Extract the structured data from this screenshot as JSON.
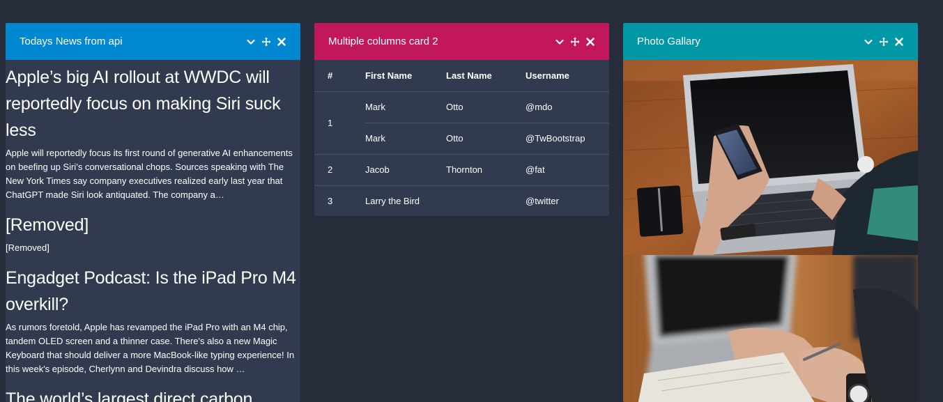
{
  "news_card": {
    "title": "Todays News from api",
    "header_color": "#0288d1",
    "articles": [
      {
        "title": "Apple’s big AI rollout at WWDC will reportedly focus on making Siri suck less",
        "description": "Apple will reportedly focus its first round of generative AI enhancements on beefing up Siri’s conversational chops. Sources speaking with The New York Times say company executives realized early last year that ChatGPT made Siri look antiquated. The company a…"
      },
      {
        "title": "[Removed]",
        "description": "[Removed]"
      },
      {
        "title": "Engadget Podcast: Is the iPad Pro M4 overkill?",
        "description": "As rumors foretold, Apple has revamped the iPad Pro with an M4 chip, tandem OLED screen and a thinner case. There's also a new Magic Keyboard that should deliver a more MacBook-like typing experience! In this week's episode, Cherlynn and Devindra discuss how …"
      },
      {
        "title": "The world’s largest direct carbon",
        "description": ""
      }
    ]
  },
  "table_card": {
    "title": "Multiple columns card 2",
    "header_color": "#c2185b",
    "columns": [
      "#",
      "First Name",
      "Last Name",
      "Username"
    ],
    "rows": [
      {
        "num": "1",
        "first": "Mark",
        "last": "Otto",
        "username": "@mdo"
      },
      {
        "num": "",
        "first": "Mark",
        "last": "Otto",
        "username": "@TwBootstrap"
      },
      {
        "num": "2",
        "first": "Jacob",
        "last": "Thornton",
        "username": "@fat"
      },
      {
        "num": "3",
        "first": "Larry the Bird",
        "last": "",
        "username": "@twitter"
      }
    ]
  },
  "gallery_card": {
    "title": "Photo Gallary",
    "header_color": "#0097a7"
  },
  "icons": [
    "chevron-down-icon",
    "move-icon",
    "close-icon"
  ]
}
